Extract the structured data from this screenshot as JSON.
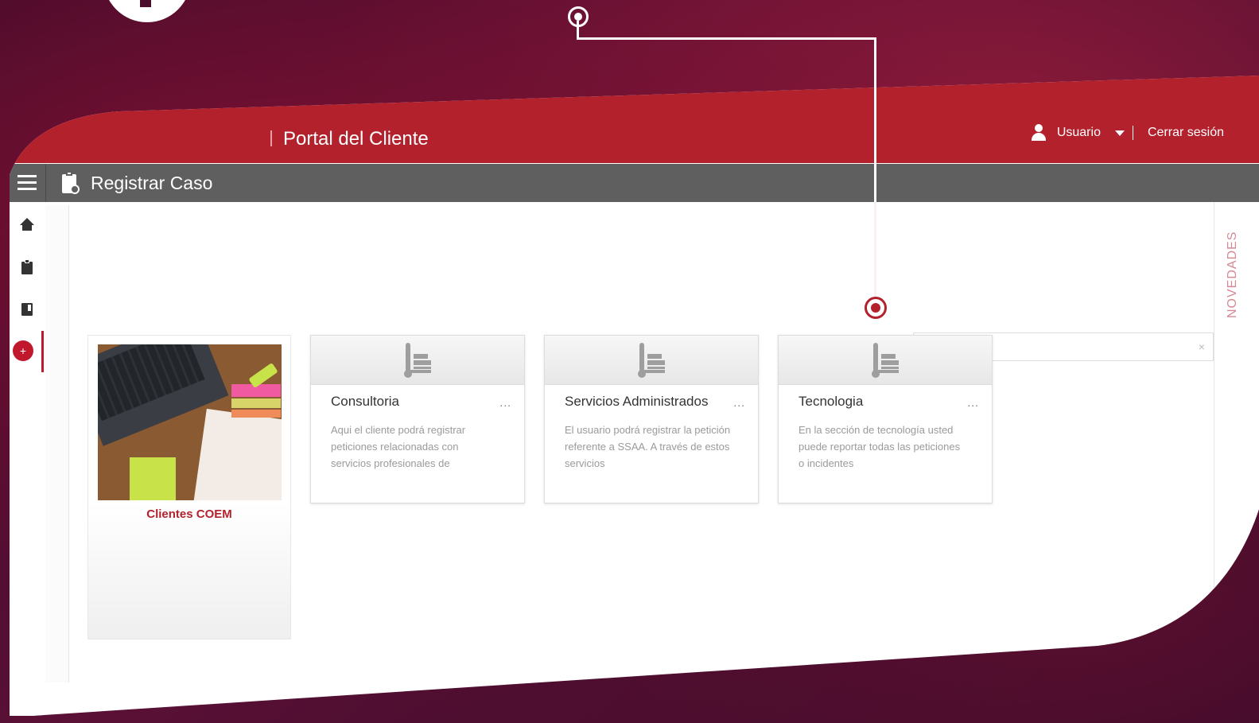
{
  "header": {
    "portal_title": "Portal del Cliente",
    "user_label": "Usuario",
    "logout_label": "Cerrar sesión"
  },
  "toolbar": {
    "page_title": "Registrar Caso",
    "search_placeholder": "",
    "search_clear": "×"
  },
  "sidebar": {
    "items": [
      {
        "icon": "home-icon"
      },
      {
        "icon": "clipboard-icon"
      },
      {
        "icon": "book-icon"
      },
      {
        "icon": "add-circle-icon",
        "label": "+",
        "active": true
      }
    ]
  },
  "right_rail": {
    "label": "NOVEDADES"
  },
  "featured": {
    "title": "Clientes COEM"
  },
  "cards": [
    {
      "title": "Consultoria",
      "more": "...",
      "description": "Aqui el cliente podrá registrar peticiones relacionadas con servicios profesionales de"
    },
    {
      "title": "Servicios Administrados",
      "more": "...",
      "description": "El usuario podrá registrar la petición referente a SSAA. A través de estos servicios"
    },
    {
      "title": "Tecnologia",
      "more": "...",
      "description": "En la sección de tecnología usted puede reportar todas las peticiones o incidentes"
    }
  ],
  "colors": {
    "brand": "#b3212d",
    "toolbar": "#5f5f5f",
    "accent": "#c0182c"
  }
}
